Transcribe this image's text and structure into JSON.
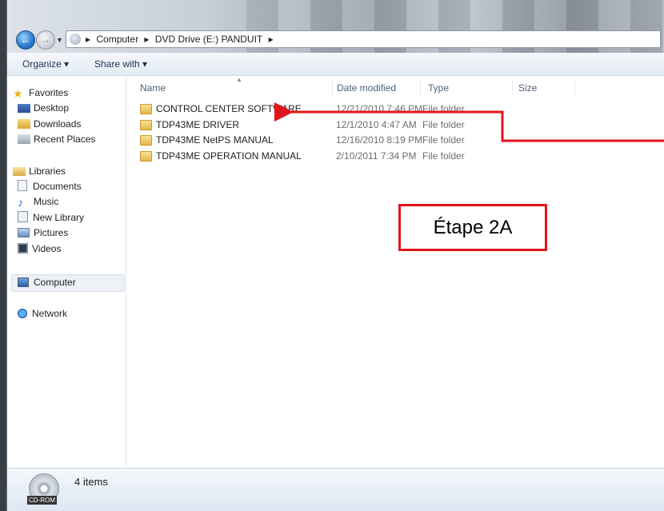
{
  "address": {
    "crumbs": [
      "Computer",
      "DVD Drive (E:) PANDUIT"
    ],
    "separator": "▸"
  },
  "toolbar": {
    "organize_label": "Organize ▾",
    "share_label": "Share with ▾"
  },
  "nav": {
    "favorites_label": "Favorites",
    "favorites": [
      "Desktop",
      "Downloads",
      "Recent Places"
    ],
    "libraries_label": "Libraries",
    "libraries": [
      "Documents",
      "Music",
      "New Library",
      "Pictures",
      "Videos"
    ],
    "computer_label": "Computer",
    "network_label": "Network"
  },
  "columns": {
    "name": "Name",
    "date": "Date modified",
    "type": "Type",
    "size": "Size"
  },
  "files": [
    {
      "name": "CONTROL CENTER SOFTWARE",
      "date": "12/21/2010 7:46 PM",
      "type": "File folder"
    },
    {
      "name": "TDP43ME DRIVER",
      "date": "12/1/2010 4:47 AM",
      "type": "File folder"
    },
    {
      "name": "TDP43ME NetPS MANUAL",
      "date": "12/16/2010 8:19 PM",
      "type": "File folder"
    },
    {
      "name": "TDP43ME OPERATION MANUAL",
      "date": "2/10/2011 7:34 PM",
      "type": "File folder"
    }
  ],
  "details": {
    "drive_label": "CD-ROM",
    "items_count": "4 items"
  },
  "annotation": {
    "step_label": "Étape 2A",
    "color": "#e0141b"
  }
}
